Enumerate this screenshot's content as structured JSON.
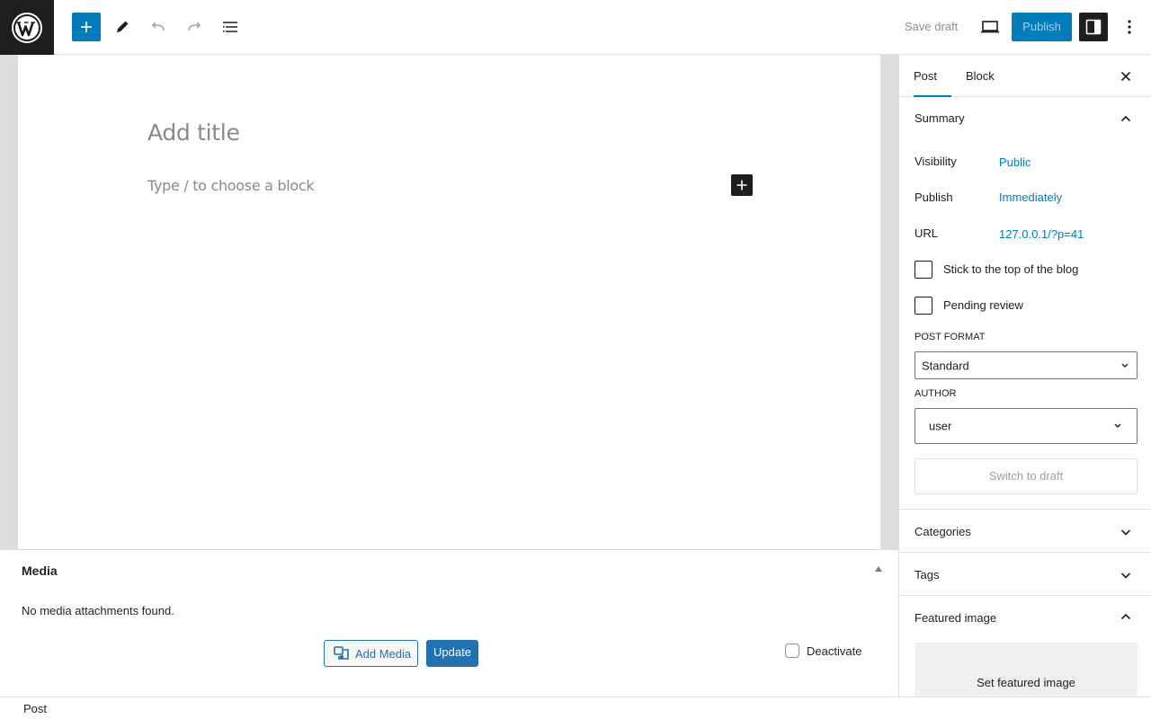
{
  "toolbar": {
    "logo_icon": "wordpress-logo",
    "add_block_icon": "plus-icon",
    "tools_icon": "pencil-icon",
    "undo_icon": "undo-icon",
    "redo_icon": "redo-icon",
    "list_view_icon": "list-view-icon",
    "save_draft_label": "Save draft",
    "preview_icon": "desktop-preview-icon",
    "publish_label": "Publish",
    "settings_icon": "sidebar-toggle-icon",
    "options_icon": "kebab-menu-icon",
    "accent_color": "#007cba"
  },
  "editor": {
    "title_placeholder": "Add title",
    "block_placeholder": "Type / to choose a block"
  },
  "media": {
    "title": "Media",
    "empty_text": "No media attachments found.",
    "add_media_label": "Add Media",
    "update_label": "Update",
    "deactivate_label": "Deactivate"
  },
  "footer": {
    "breadcrumb": "Post"
  },
  "sidebar": {
    "tabs": [
      {
        "label": "Post",
        "active": true
      },
      {
        "label": "Block",
        "active": false
      }
    ],
    "summary": {
      "title": "Summary",
      "rows": [
        {
          "label": "Visibility",
          "value": "Public"
        },
        {
          "label": "Publish",
          "value": "Immediately"
        },
        {
          "label": "URL",
          "value": "127.0.0.1/?p=41"
        }
      ],
      "checkboxes": [
        {
          "label": "Stick to the top of the blog",
          "checked": false
        },
        {
          "label": "Pending review",
          "checked": false
        }
      ],
      "post_format_label": "POST FORMAT",
      "post_format_value": "Standard",
      "author_label": "AUTHOR",
      "author_value": "user",
      "switch_to_draft_label": "Switch to draft"
    },
    "panels": {
      "categories": "Categories",
      "tags": "Tags",
      "featured_image": "Featured image",
      "set_featured_image": "Set featured image"
    }
  }
}
